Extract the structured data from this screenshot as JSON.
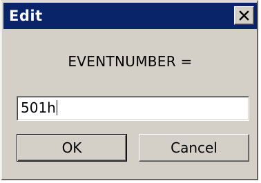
{
  "window": {
    "title": "Edit",
    "close_icon": "close-icon",
    "titlebar_color": "#0a246a",
    "body_color": "#d4d0c8"
  },
  "prompt": {
    "label": "EVENTNUMBER ="
  },
  "input": {
    "value": "501h"
  },
  "buttons": {
    "ok_label": "OK",
    "cancel_label": "Cancel"
  }
}
